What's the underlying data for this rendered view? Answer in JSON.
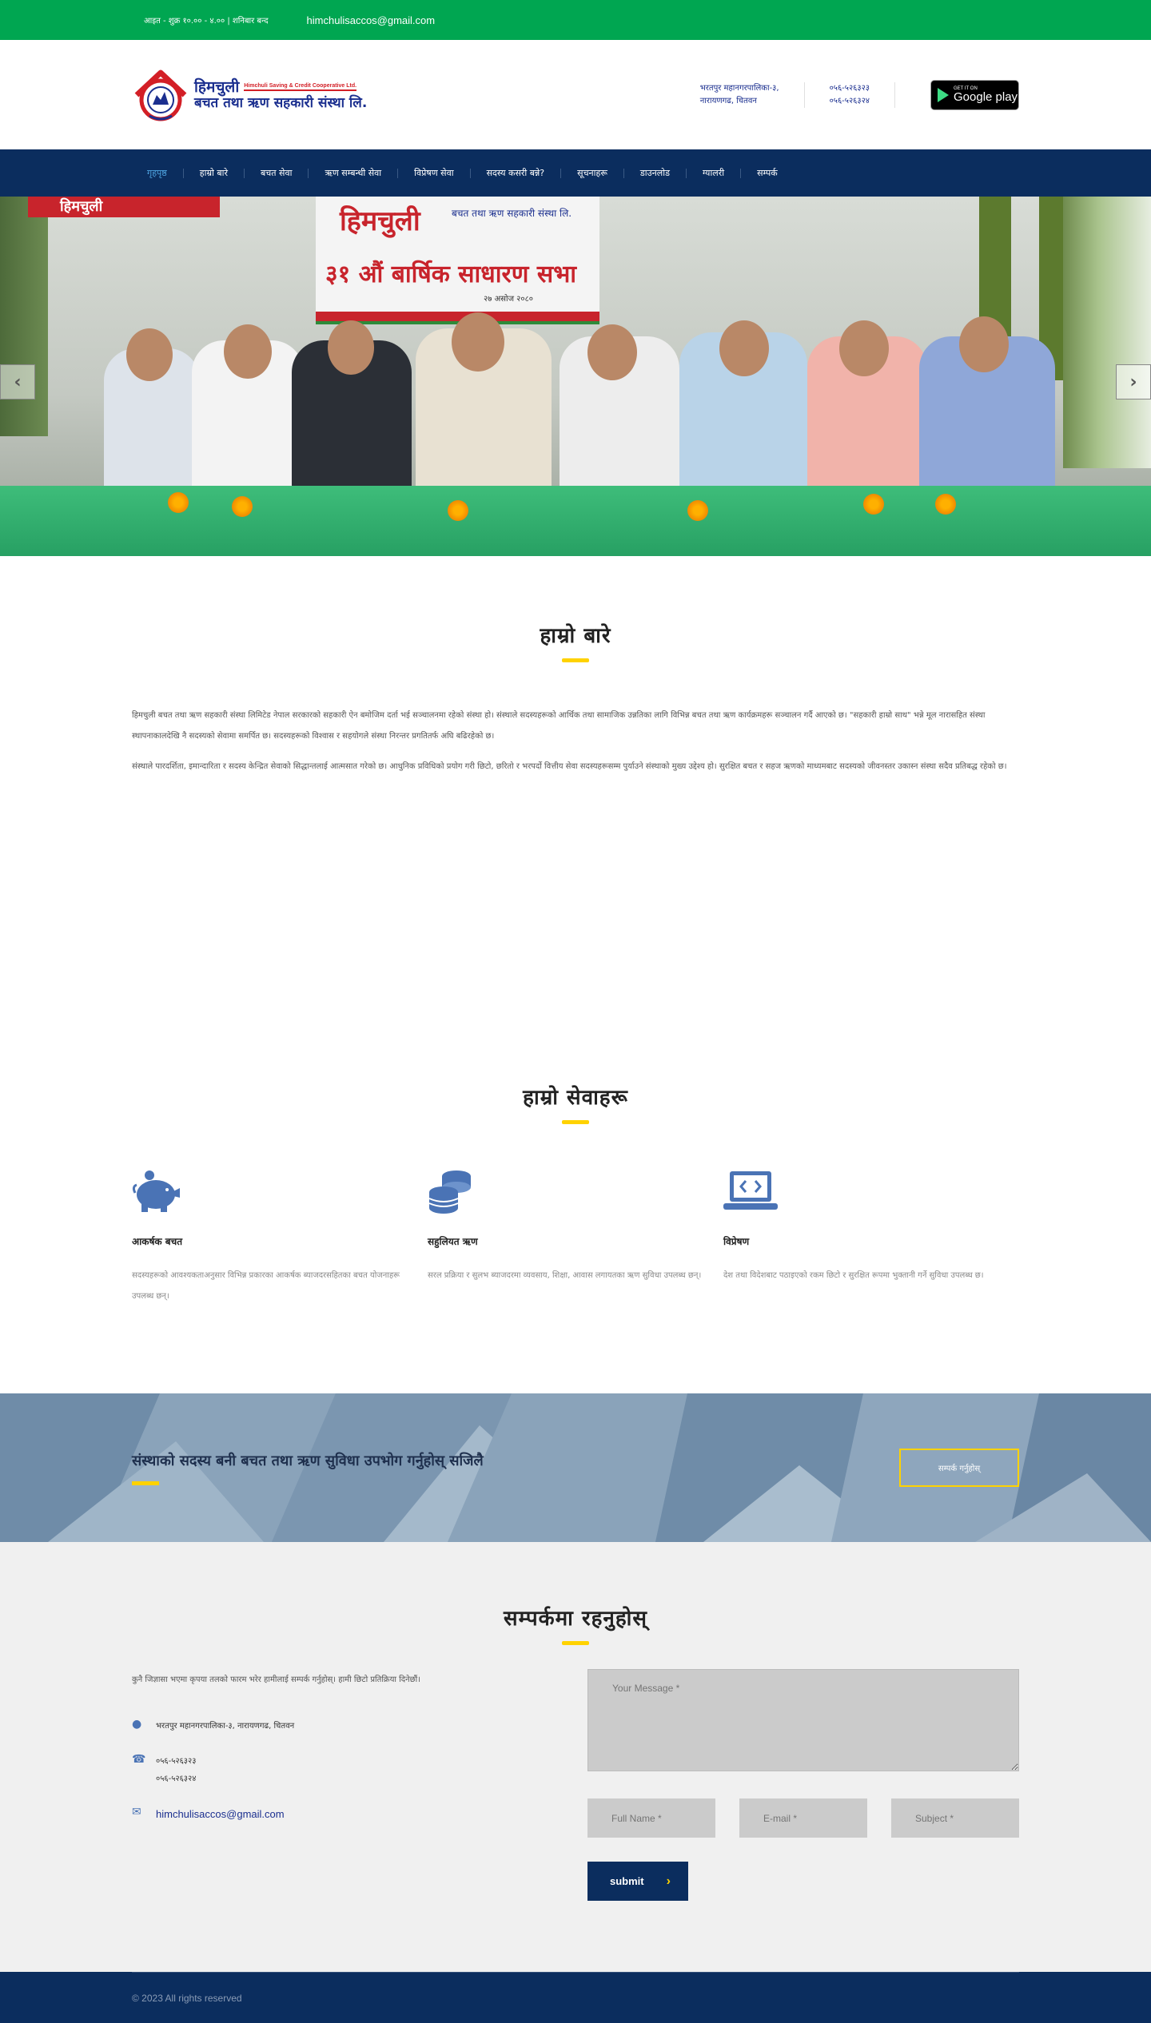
{
  "topbar": {
    "hours": "आइत - शुक्र १०.०० - ४.०० | शनिबार बन्द",
    "email": "himchulisaccos@gmail.com"
  },
  "header": {
    "logo_np_line1": "हिमचुली",
    "logo_en": "Himchuli Saving & Credit Cooperative Ltd.",
    "logo_np_line2": "बचत तथा ऋण सहकारी संस्था लि.",
    "address_line1": "भरतपुर महानगरपालिका-३,",
    "address_line2": "नारायणगढ, चितवन",
    "phone1": "०५६-५२६३२३",
    "phone2": "०५६-५२६३२४",
    "gplay_small": "GET IT ON",
    "gplay_big": "Google play"
  },
  "nav": {
    "items": [
      "गृहपृष्ठ",
      "हाम्रो बारे",
      "बचत सेवा",
      "ऋण सम्बन्धी सेवा",
      "विप्रेषण सेवा",
      "सदस्य कसरी बन्ने?",
      "सूचनाहरू",
      "डाउनलोड",
      "ग्यालरी",
      "सम्पर्क"
    ]
  },
  "hero": {
    "banner_name": "हिमचुली",
    "banner_sub": "बचत तथा ऋण सहकारी संस्था लि.",
    "banner_meeting": "३१ औं बार्षिक साधारण सभा",
    "banner_date": "२७ असोज २०८०",
    "banner_corner": "हिमचुली",
    "prev": "‹",
    "next": "›"
  },
  "about": {
    "title": "हाम्रो बारे",
    "p1": "हिमचुली बचत तथा ऋण सहकारी संस्था लिमिटेड नेपाल सरकारको सहकारी ऐन बमोजिम दर्ता भई सञ्चालनमा रहेको संस्था हो। संस्थाले सदस्यहरूको आर्थिक तथा सामाजिक उन्नतिका लागि विभिन्न बचत तथा ऋण कार्यक्रमहरू सञ्चालन गर्दै आएको छ। \"सहकारी हाम्रो साथ\" भन्ने मूल नारासहित संस्था स्थापनाकालदेखि नै सदस्यको सेवामा समर्पित छ। सदस्यहरूको विश्वास र सहयोगले संस्था निरन्तर प्रगतितर्फ अघि बढिरहेको छ।",
    "p2": "संस्थाले पारदर्शिता, इमान्दारिता र सदस्य केन्द्रित सेवाको सिद्धान्तलाई आत्मसात गरेको छ। आधुनिक प्रविधिको प्रयोग गरी छिटो, छरितो र भरपर्दो वित्तीय सेवा सदस्यहरूसम्म पुर्याउने संस्थाको मुख्य उद्देश्य हो। सुरक्षित बचत र सहज ऋणको माध्यमबाट सदस्यको जीवनस्तर उकास्न संस्था सदैव प्रतिबद्ध रहेको छ।"
  },
  "services": {
    "title": "हाम्रो सेवाहरू",
    "items": [
      {
        "title": "आकर्षक बचत",
        "text": "सदस्यहरूको आवश्यकताअनुसार विभिन्न प्रकारका आकर्षक ब्याजदरसहितका बचत योजनाहरू उपलब्ध छन्।"
      },
      {
        "title": "सहुलियत ऋण",
        "text": "सरल प्रक्रिया र सुलभ ब्याजदरमा व्यवसाय, शिक्षा, आवास लगायतका ऋण सुविधा उपलब्ध छन्।"
      },
      {
        "title": "विप्रेषण",
        "text": "देश तथा विदेशबाट पठाइएको रकम छिटो र सुरक्षित रूपमा भुक्तानी गर्ने सुविधा उपलब्ध छ।"
      }
    ]
  },
  "cta": {
    "text": "संस्थाको सदस्य बनी बचत तथा ऋण सुविधा उपभोग गर्नुहोस् सजिलै",
    "button": "सम्पर्क गर्नुहोस्"
  },
  "contact": {
    "title": "सम्पर्कमा रहनुहोस्",
    "intro": "कुनै जिज्ञासा भएमा कृपया तलको फारम भरेर हामीलाई सम्पर्क गर्नुहोस्। हामी छिटो प्रतिक्रिया दिनेछौं।",
    "address": "भरतपुर महानगरपालिका-३, नारायणगढ, चितवन",
    "phone1": "०५६-५२६३२३",
    "phone2": "०५६-५२६३२४",
    "email": "himchulisaccos@gmail.com",
    "message_placeholder": "Your Message *",
    "name_placeholder": "Full Name *",
    "email_placeholder": "E-mail *",
    "subject_placeholder": "Subject *",
    "submit_label": "submit"
  },
  "footer": {
    "copyright": "© 2023 All rights reserved"
  },
  "colors": {
    "topbar": "#00a651",
    "nav": "#0b2d5e",
    "accent": "#ffd200",
    "brand_blue": "#1b2f8f",
    "brand_red": "#d31f26"
  },
  "icons": {
    "savings": "piggy-bank-icon",
    "loan": "coins-icon",
    "remit": "laptop-code-icon",
    "address": "map-marker-icon",
    "phone": "phone-icon",
    "email": "envelope-icon"
  }
}
